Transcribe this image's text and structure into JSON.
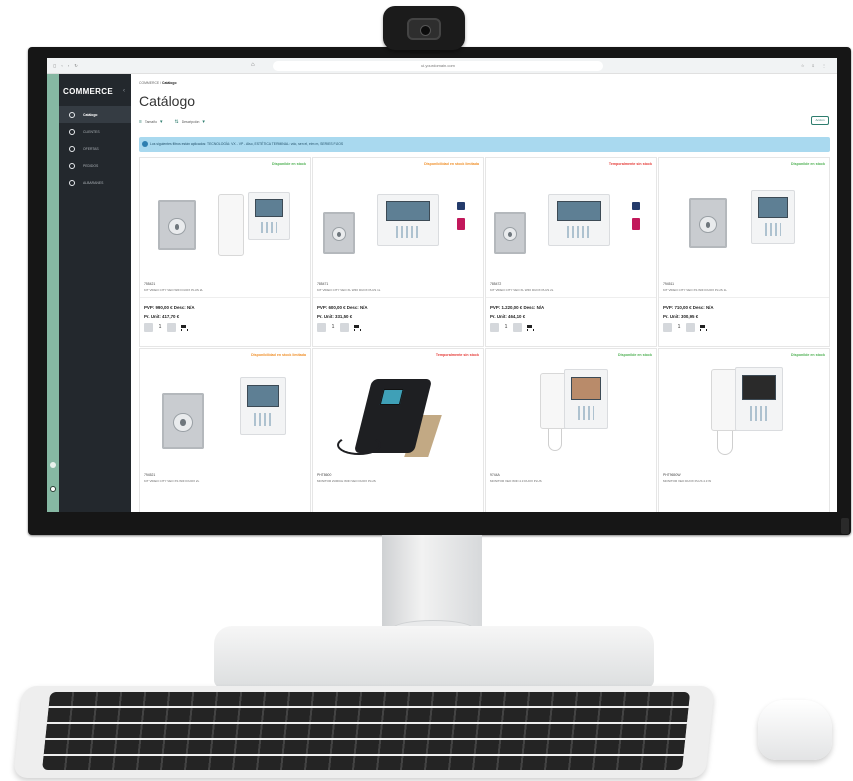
{
  "browser": {
    "nav_glyphs": "◻ ‹ › ↻",
    "home_glyph": "⌂",
    "url": "ui.yourdomain.com",
    "tool_glyphs": "☆ ⇩ ⋮"
  },
  "sidebar": {
    "brand": "COMMERCE",
    "toggle": "‹",
    "items": [
      {
        "label": "Catálogo",
        "active": true
      },
      {
        "label": "CLIENTES",
        "active": false
      },
      {
        "label": "OFERTAS",
        "active": false
      },
      {
        "label": "PEDIDOS",
        "active": false
      },
      {
        "label": "ALBARANES",
        "active": false
      }
    ]
  },
  "main": {
    "breadcrumb_root": "COMMERCE",
    "breadcrumb_sep": "/",
    "breadcrumb_current": "Catálogo",
    "title": "Catálogo",
    "filter_sort": "Tamaño",
    "filter_desc": "Descripción",
    "action_button": "Acción",
    "info": "Los siguientes filtros están aplicados: TECNOLOGÍA: VX - VP - Also, ESTÉTICA TERMINAL: vdo, sen el, eim m, SERIES FIJOS"
  },
  "products": [
    {
      "availability": "Disponible en stock",
      "status": "green",
      "code": "755421",
      "description": "KIT VIDEO CITY VEO WIFI DUOX PLUS 2L",
      "price": "PVP: 990,00 € Desc: N/A",
      "unit": "Pr. Unit: 417,70 €",
      "qty": "1"
    },
    {
      "availability": "Disponibilidad en stock limitada",
      "status": "orange",
      "code": "785471",
      "description": "KIT VIDEO CITY VEO XL WIFI DUOX PLUS 1L",
      "price": "PVP: 600,00 € Desc: N/A",
      "unit": "Pr. Unit: 331,50 €",
      "qty": "1"
    },
    {
      "availability": "Temporalmente sin stock",
      "status": "red",
      "code": "785472",
      "description": "KIT VIDEO CITY VEO XL WIFI DUOX PLUS 2L",
      "price": "PVP: 1.220,00 € Desc: N/A",
      "unit": "Pr. Unit: 464,10 €",
      "qty": "1"
    },
    {
      "availability": "Disponible en stock",
      "status": "green",
      "code": "794511",
      "description": "KIT VIDEO CITY VEO XS WIFI DUOX PLUS 1L",
      "price": "PVP: 710,00 € Desc: N/A",
      "unit": "Pr. Unit: 300,95 €",
      "qty": "1"
    },
    {
      "availability": "Disponibilidad en stock limitada",
      "status": "orange",
      "code": "794521",
      "description": "KIT VIDEO CITY VEO XS WIFI DUOX 2L",
      "price": "",
      "unit": "",
      "qty": ""
    },
    {
      "availability": "Temporalmente sin stock",
      "status": "red",
      "code": "PHT8600",
      "description": "MONITOR ZURICH WIFI VEO DUOX PLUS",
      "price": "",
      "unit": "",
      "qty": ""
    },
    {
      "availability": "Disponible en stock",
      "status": "green",
      "code": "9744A",
      "description": "MONITOR VEO WIFI 4.3 DUOX PLUS",
      "price": "",
      "unit": "",
      "qty": ""
    },
    {
      "availability": "Disponible en stock",
      "status": "green",
      "code": "PHT9650W",
      "description": "MONITOR VEO DUOX PLUS 4.3 W",
      "price": "",
      "unit": "",
      "qty": ""
    }
  ],
  "colors": {
    "sidebar": "#23282d",
    "accent_strip": "#86b8a3",
    "info_bar": "#a9d9ef",
    "available": "#4caf50",
    "limited": "#f0902a",
    "out_of_stock": "#e53935"
  },
  "icons": {
    "menu_item": "circle-icon",
    "cart": "cart-icon",
    "info": "info-icon",
    "filter": "filter-icon"
  }
}
